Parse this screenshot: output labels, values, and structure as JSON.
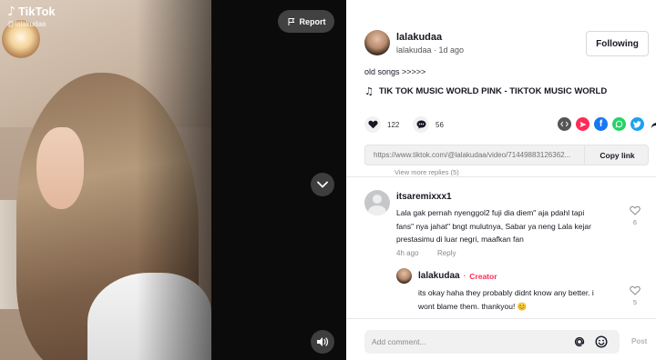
{
  "video": {
    "watermark_brand": "TikTok",
    "watermark_user": "@lalakudaa",
    "report_label": "Report"
  },
  "author": {
    "name": "lalakudaa",
    "meta": "lalakudaa · 1d ago",
    "follow_label": "Following"
  },
  "post": {
    "caption": "old songs >>>>>",
    "music": "TIK TOK MUSIC WORLD PINK - TIKTOK MUSIC WORLD",
    "likes": "122",
    "comments": "56",
    "url": "https://www.tiktok.com/@lalakudaa/video/71449883126362...",
    "copy_label": "Copy link"
  },
  "share_icons": [
    {
      "name": "embed-icon",
      "color": "#555555"
    },
    {
      "name": "send-icon",
      "color": "#fe2c55"
    },
    {
      "name": "facebook-icon",
      "color": "#1877f2"
    },
    {
      "name": "whatsapp-icon",
      "color": "#25d366"
    },
    {
      "name": "twitter-icon",
      "color": "#1da1f2"
    },
    {
      "name": "share-arrow-icon",
      "color": "#161823"
    }
  ],
  "comments": {
    "view_more": "View more replies (5)",
    "items": [
      {
        "user": "itsaremixxx1",
        "text": "Lala gak pernah nyenggol2 fuji dia diem\" aja pdahl tapi fans\" nya jahat\" bngt mulutnya, Sabar ya neng Lala kejar prestasimu di luar negri, maafkan fan",
        "time": "4h ago",
        "reply_label": "Reply",
        "likes": "6"
      }
    ],
    "reply": {
      "user": "lalakudaa",
      "separator": "·",
      "badge": "Creator",
      "text": "its okay haha they probably didnt know any better. i wont blame them. thankyou! 😊",
      "likes": "5"
    }
  },
  "composer": {
    "placeholder": "Add comment...",
    "post_label": "Post"
  },
  "colors": {
    "accent": "#fe2c55",
    "text": "#161823",
    "muted": "#8a8a8a"
  }
}
